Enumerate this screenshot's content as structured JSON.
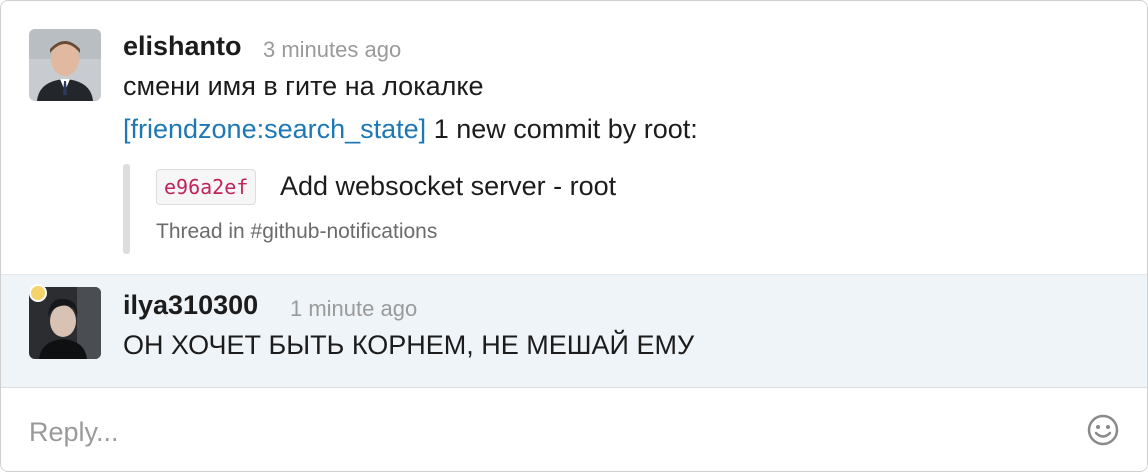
{
  "messages": [
    {
      "username": "elishanto",
      "timestamp": "3 minutes ago",
      "text": "смени имя в гите на локалке",
      "bot_link": "[friendzone:search_state]",
      "bot_text": " 1 new commit by root:",
      "commit_hash": "e96a2ef",
      "commit_message": "Add websocket server - root",
      "thread_info": "Thread in #github-notifications"
    },
    {
      "username": "ilya310300",
      "timestamp": "1 minute ago",
      "text": "ОН ХОЧЕТ БЫТЬ КОРНЕМ, НЕ МЕШАЙ ЕМУ"
    }
  ],
  "reply": {
    "placeholder": "Reply..."
  },
  "icons": {
    "emoji": "smiley-face-icon",
    "status": "status-dot-icon"
  },
  "colors": {
    "link": "#1d78b4",
    "commit_hash": "#c0245c",
    "highlight_bg": "#eef4f7"
  }
}
